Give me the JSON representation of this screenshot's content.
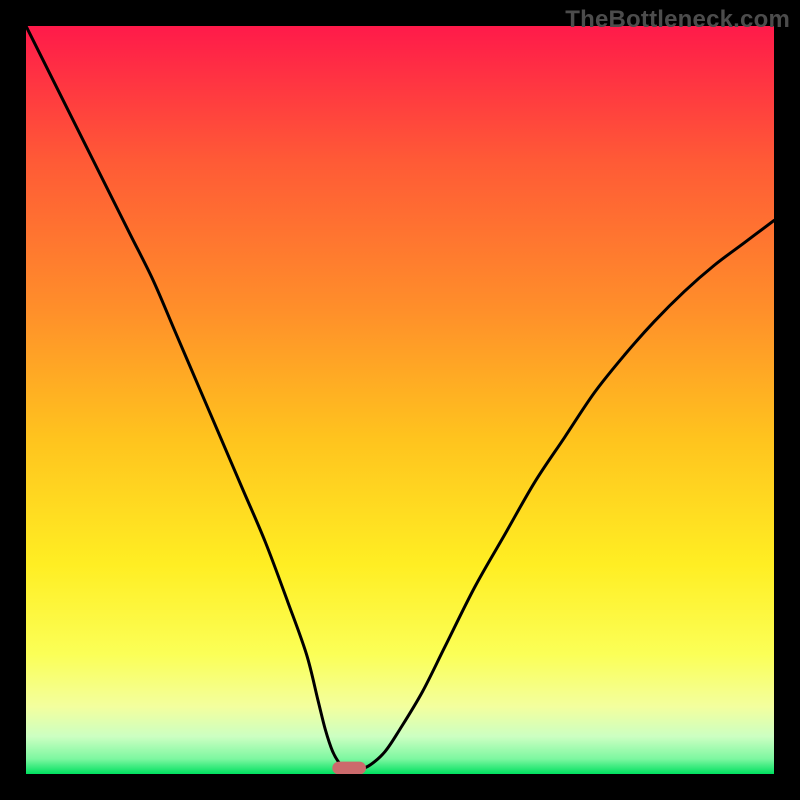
{
  "watermark": "TheBottleneck.com",
  "chart_data": {
    "type": "line",
    "title": "",
    "xlabel": "",
    "ylabel": "",
    "xlim": [
      0,
      100
    ],
    "ylim": [
      0,
      100
    ],
    "background_gradient": [
      "#ff1a4a",
      "#ff6a2e",
      "#ffc31e",
      "#ffee23",
      "#f7ff6e",
      "#a8ffb0",
      "#00e060"
    ],
    "series": [
      {
        "name": "bottleneck-curve",
        "color": "#000000",
        "x": [
          0,
          2,
          5,
          8,
          11,
          14,
          17,
          20,
          23,
          26,
          29,
          32,
          35,
          37.5,
          39,
          40,
          41,
          42,
          42.8,
          44.5,
          46,
          48,
          50,
          53,
          56,
          60,
          64,
          68,
          72,
          76,
          80,
          84,
          88,
          92,
          96,
          100
        ],
        "y": [
          100,
          96,
          90,
          84,
          78,
          72,
          66,
          59,
          52,
          45,
          38,
          31,
          23,
          16,
          10,
          6,
          3,
          1.3,
          0.6,
          0.6,
          1.2,
          3,
          6,
          11,
          17,
          25,
          32,
          39,
          45,
          51,
          56,
          60.5,
          64.5,
          68,
          71,
          74
        ]
      }
    ],
    "marker": {
      "name": "optimal-range",
      "x": 43.2,
      "y": 0.8,
      "color": "#cc6a6c",
      "width_pct": 4.5,
      "height_pct": 1.7
    }
  }
}
